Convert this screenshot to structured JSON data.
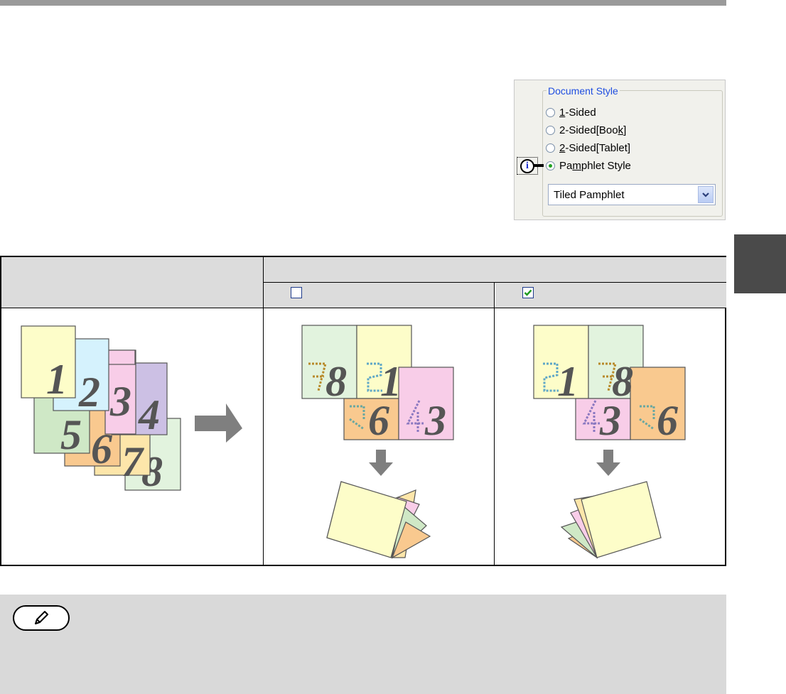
{
  "document_style": {
    "legend": "Document Style",
    "options": [
      {
        "pre": "",
        "ul": "1",
        "post": "-Sided"
      },
      {
        "pre": "2-Sided[Boo",
        "ul": "k",
        "post": "]"
      },
      {
        "pre": "",
        "ul": "2",
        "post": "-Sided[Tablet]"
      },
      {
        "pre": "Pa",
        "ul": "m",
        "post": "phlet Style"
      }
    ],
    "selected_option": "Pamphlet Style",
    "dropdown_value": "Tiled Pamphlet"
  },
  "table": {
    "checkbox_unchecked": false,
    "checkbox_checked": true
  },
  "page_numbers": [
    "1",
    "2",
    "3",
    "4",
    "5",
    "6",
    "7",
    "8"
  ],
  "colors": {
    "topbar": "#9a9a9a",
    "sidetab": "#4a4a4a",
    "header_bg": "#dcdcdc",
    "note_bg": "#d9d9d9",
    "page_yellow": "#fdfdc9",
    "page_blue": "#d5f2fd",
    "page_pink": "#f8cde8",
    "page_purple": "#ccc0e4",
    "page_green": "#cfe8c6",
    "page_orange": "#f9c98f",
    "page_lightyellow": "#fde6aa",
    "page_lightgreen": "#e2f3de",
    "arrow_gray": "#7f7f7f"
  }
}
